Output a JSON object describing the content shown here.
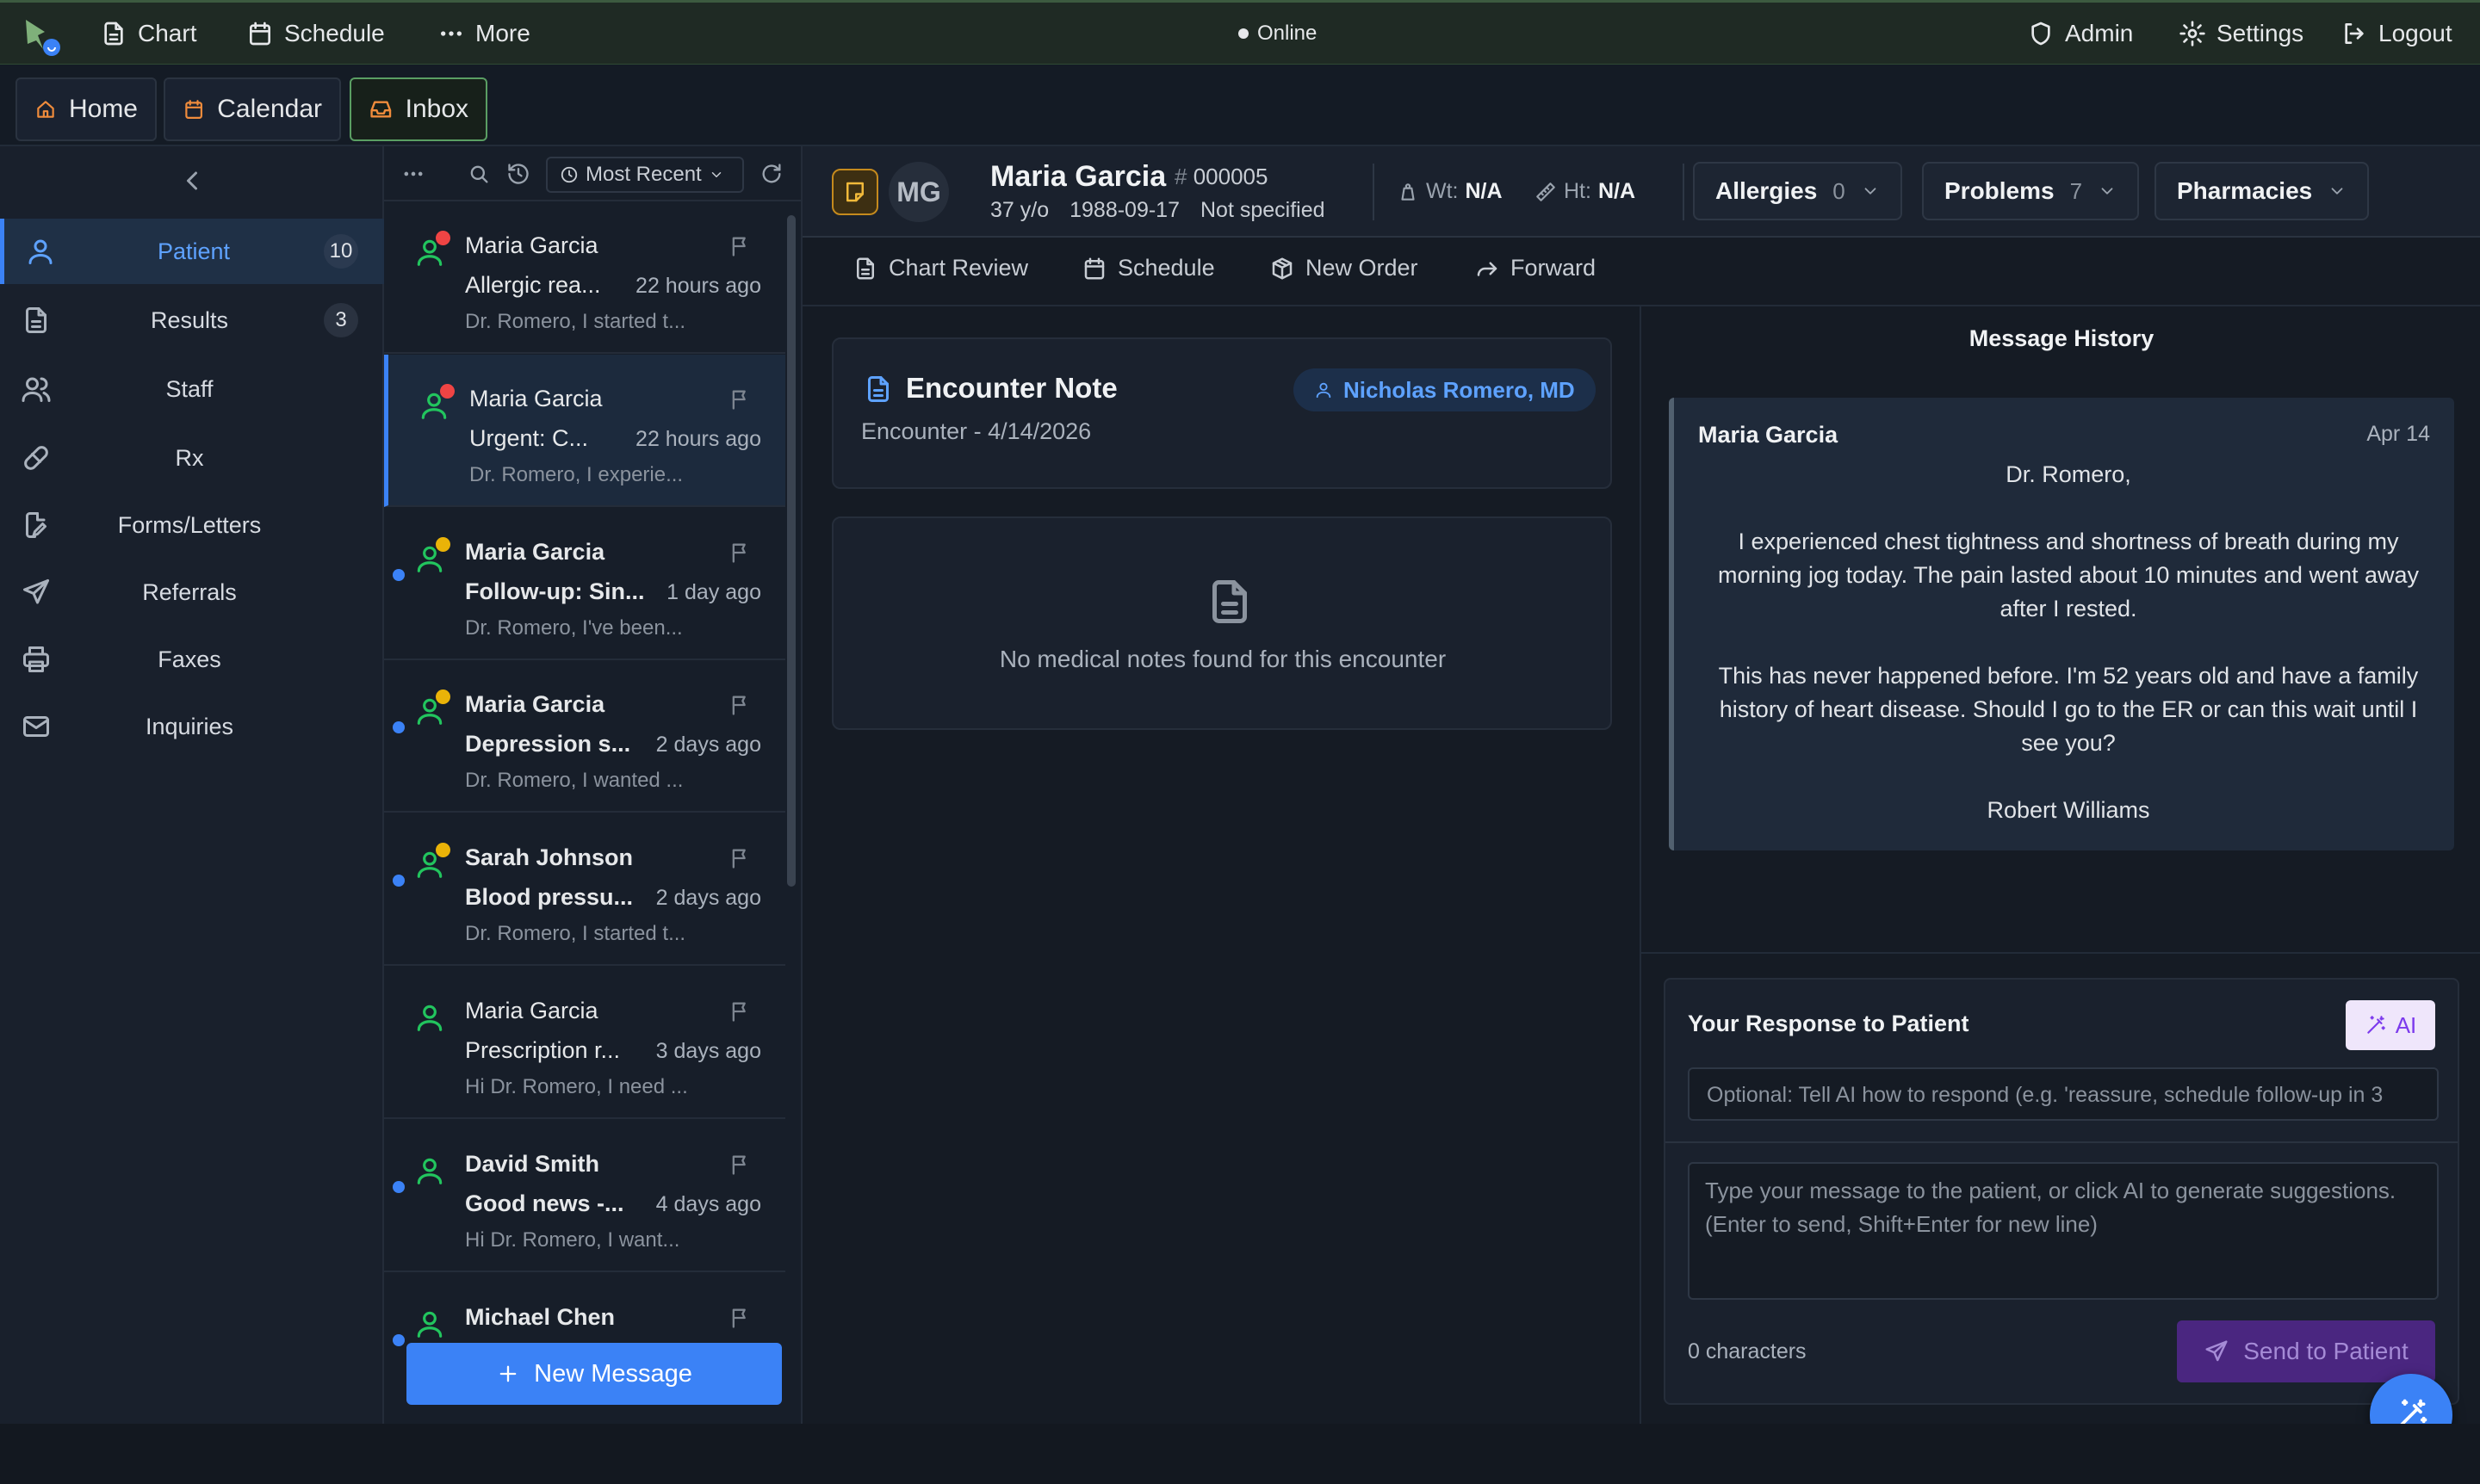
{
  "topbar": {
    "nav": [
      {
        "label": "Chart",
        "icon": "document-icon"
      },
      {
        "label": "Schedule",
        "icon": "calendar-icon"
      },
      {
        "label": "More",
        "icon": "ellipsis-icon"
      }
    ],
    "status": "Online",
    "right": [
      {
        "label": "Admin",
        "icon": "shield-icon"
      },
      {
        "label": "Settings",
        "icon": "gear-icon"
      },
      {
        "label": "Logout",
        "icon": "logout-icon"
      }
    ]
  },
  "tabs": [
    {
      "label": "Home",
      "icon": "home-icon"
    },
    {
      "label": "Calendar",
      "icon": "calendar-icon"
    },
    {
      "label": "Inbox",
      "icon": "inbox-icon",
      "active": true
    }
  ],
  "sidebar": {
    "items": [
      {
        "label": "Patient",
        "count": "10",
        "icon": "user-icon",
        "active": true
      },
      {
        "label": "Results",
        "count": "3",
        "icon": "file-icon"
      },
      {
        "label": "Staff",
        "count": "",
        "icon": "users-icon"
      },
      {
        "label": "Rx",
        "count": "",
        "icon": "pill-icon"
      },
      {
        "label": "Forms/Letters",
        "count": "",
        "icon": "file-edit-icon"
      },
      {
        "label": "Referrals",
        "count": "",
        "icon": "send-icon"
      },
      {
        "label": "Faxes",
        "count": "",
        "icon": "printer-icon"
      },
      {
        "label": "Inquiries",
        "count": "",
        "icon": "mail-icon"
      }
    ]
  },
  "messages": {
    "sort_label": "Most Recent",
    "new_message_label": "New Message",
    "items": [
      {
        "name": "Maria Garcia",
        "subject": "Allergic rea...",
        "time": "22 hours ago",
        "preview": "Dr. Romero, I started t...",
        "unread": false,
        "badge": "#ef4444"
      },
      {
        "name": "Maria Garcia",
        "subject": "Urgent: C...",
        "time": "22 hours ago",
        "preview": "Dr. Romero, I experie...",
        "unread": false,
        "badge": "#ef4444",
        "selected": true
      },
      {
        "name": "Maria Garcia",
        "subject": "Follow-up: Sin...",
        "time": "1 day ago",
        "preview": "Dr. Romero, I've been...",
        "unread": true,
        "badge": "#eab308"
      },
      {
        "name": "Maria Garcia",
        "subject": "Depression s...",
        "time": "2 days ago",
        "preview": "Dr. Romero, I wanted ...",
        "unread": true,
        "badge": "#eab308"
      },
      {
        "name": "Sarah Johnson",
        "subject": "Blood pressu...",
        "time": "2 days ago",
        "preview": "Dr. Romero, I started t...",
        "unread": true,
        "badge": "#eab308"
      },
      {
        "name": "Maria Garcia",
        "subject": "Prescription r...",
        "time": "3 days ago",
        "preview": "Hi Dr. Romero, I need ...",
        "unread": false,
        "badge": ""
      },
      {
        "name": "David Smith",
        "subject": "Good news -...",
        "time": "4 days ago",
        "preview": "Hi Dr. Romero, I want...",
        "unread": true,
        "badge": ""
      },
      {
        "name": "Michael Chen",
        "subject": "",
        "time": "",
        "preview": "",
        "unread": true,
        "badge": ""
      }
    ]
  },
  "patient": {
    "initials": "MG",
    "name": "Maria Garcia",
    "id": "000005",
    "age": "37 y/o",
    "dob": "1988-09-17",
    "sex": "Not specified",
    "wt_label": "Wt:",
    "wt": "N/A",
    "ht_label": "Ht:",
    "ht": "N/A",
    "pills": [
      {
        "label": "Allergies",
        "count": "0"
      },
      {
        "label": "Problems",
        "count": "7"
      },
      {
        "label": "Pharmacies",
        "count": ""
      }
    ]
  },
  "actions": [
    {
      "label": "Chart Review",
      "icon": "document-icon"
    },
    {
      "label": "Schedule",
      "icon": "calendar-icon"
    },
    {
      "label": "New Order",
      "icon": "package-icon"
    },
    {
      "label": "Forward",
      "icon": "forward-icon"
    }
  ],
  "encounter": {
    "title": "Encounter Note",
    "subtitle": "Encounter - 4/14/2026",
    "provider": "Nicholas Romero, MD",
    "empty_text": "No medical notes found for this encounter"
  },
  "history": {
    "title": "Message History",
    "from": "Maria Garcia",
    "date": "Apr 14",
    "body": "Dr. Romero,\n\nI experienced chest tightness and shortness of breath during my morning jog today. The pain lasted about 10 minutes and went away after I rested.\n\nThis has never happened before. I'm 52 years old and have a family history of heart disease. Should I go to the ER or can this wait until I see you?\n\nRobert Williams"
  },
  "response": {
    "title": "Your Response to Patient",
    "ai_label": "AI",
    "ai_placeholder": "Optional: Tell AI how to respond (e.g. 'reassure, schedule follow-up in 3",
    "message_placeholder": "Type your message to the patient, or click AI to generate suggestions. (Enter to send, Shift+Enter for new line)",
    "char_count": "0 characters",
    "send_label": "Send to Patient"
  },
  "colors": {
    "accent": "#3b82f6",
    "success": "#22c55e",
    "warning": "#eab308",
    "danger": "#ef4444",
    "ai": "#7c3aed"
  }
}
